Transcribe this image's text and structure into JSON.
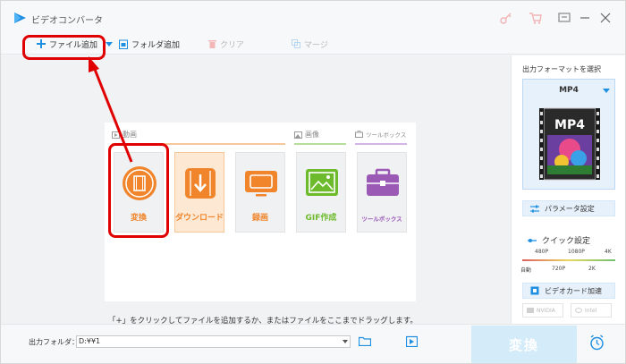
{
  "app": {
    "title": "ビデオコンバータ"
  },
  "toolbar": {
    "add_file": "ファイル追加",
    "add_folder": "フォルダ追加",
    "clear": "クリア",
    "merge": "マージ"
  },
  "categories": {
    "video": "動画",
    "image": "画像",
    "toolbox": "ツールボックス"
  },
  "cards": [
    {
      "label": "変換",
      "icon": "film-icon",
      "color": "#f0852b"
    },
    {
      "label": "ダウンロード",
      "icon": "download-icon",
      "color": "#f0852b"
    },
    {
      "label": "録画",
      "icon": "screen-record-icon",
      "color": "#f0852b"
    },
    {
      "label": "GIF作成",
      "icon": "gif-image-icon",
      "color": "#6dbb2c"
    },
    {
      "label": "ツールボックス",
      "icon": "toolbox-icon",
      "color": "#9b59b6"
    }
  ],
  "hint": "「+」をクリックしてファイルを追加するか、またはファイルをここまでドラッグします。",
  "sidebar": {
    "title": "出力フォーマットを選択",
    "format": "MP4",
    "format_thumb": "MP4",
    "params": "パラメータ設定",
    "quick": "クイック設定",
    "slider_top": [
      "480P",
      "1080P",
      "4K"
    ],
    "slider_bottom": [
      "自動",
      "720P",
      "2K"
    ],
    "gpu": "ビデオカード加速",
    "nvidia": "NVIDIA",
    "intel": "Intel"
  },
  "bottom": {
    "output_label": "出力フォルダ：",
    "output_value": "D:¥¥1",
    "convert": "変換"
  },
  "colors": {
    "accent_blue": "#1e8fe1",
    "orange": "#f0852b",
    "green": "#6dbb2c",
    "purple": "#9b59b6",
    "annotation_red": "#e00000"
  }
}
